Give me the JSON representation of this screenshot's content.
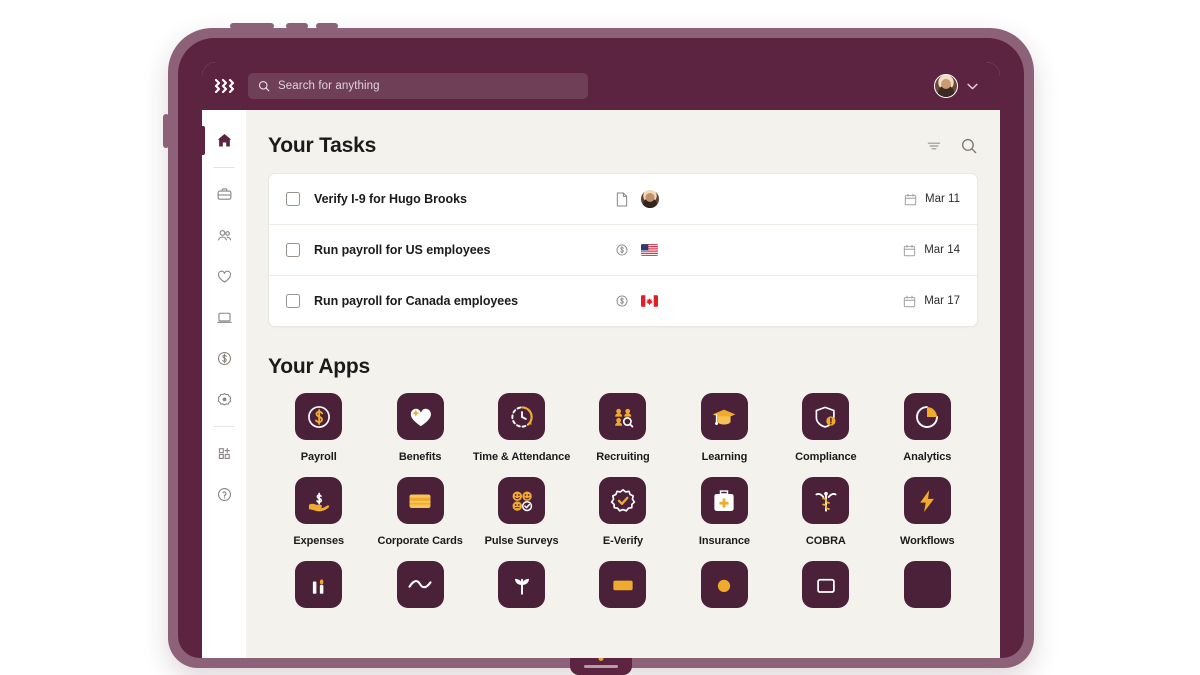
{
  "topbar": {
    "logo_icon": "rippling-logo-icon",
    "search": {
      "placeholder": "Search for anything",
      "value": "",
      "icon": "search-icon"
    },
    "account": {
      "avatar_icon": "user-avatar",
      "chevron_icon": "chevron-down-icon"
    }
  },
  "sidebar": {
    "items": [
      {
        "name": "home",
        "icon": "home-icon",
        "active": true
      },
      {
        "name": "briefcase",
        "icon": "briefcase-icon",
        "active": false
      },
      {
        "name": "people",
        "icon": "people-icon",
        "active": false
      },
      {
        "name": "benefits",
        "icon": "heart-icon",
        "active": false
      },
      {
        "name": "devices",
        "icon": "laptop-icon",
        "active": false
      },
      {
        "name": "payroll",
        "icon": "dollar-circle-icon",
        "active": false
      },
      {
        "name": "settings",
        "icon": "gear-badge-icon",
        "active": false
      },
      {
        "name": "add-apps",
        "icon": "apps-add-icon",
        "active": false
      },
      {
        "name": "help",
        "icon": "help-circle-icon",
        "active": false
      }
    ]
  },
  "tasks_section": {
    "title": "Your Tasks",
    "filter_icon": "filter-icon",
    "search_icon": "search-icon",
    "rows": [
      {
        "label": "Verify I-9 for Hugo Brooks",
        "type_icon": "document-icon",
        "entity_icon": "user-avatar",
        "entity_kind": "avatar",
        "date_icon": "calendar-icon",
        "date": "Mar 11"
      },
      {
        "label": "Run payroll for US employees",
        "type_icon": "dollar-circle-icon",
        "entity_icon": "flag-us",
        "entity_kind": "flag",
        "date_icon": "calendar-icon",
        "date": "Mar 14"
      },
      {
        "label": "Run payroll for Canada employees",
        "type_icon": "dollar-circle-icon",
        "entity_icon": "flag-ca",
        "entity_kind": "flag",
        "date_icon": "calendar-icon",
        "date": "Mar 17"
      }
    ]
  },
  "apps_section": {
    "title": "Your Apps",
    "apps": [
      {
        "label": "Payroll",
        "icon": "dollar-circle-icon"
      },
      {
        "label": "Benefits",
        "icon": "heart-plus-icon"
      },
      {
        "label": "Time & Attendance",
        "icon": "clock-arrow-icon"
      },
      {
        "label": "Recruiting",
        "icon": "people-search-icon"
      },
      {
        "label": "Learning",
        "icon": "graduation-cap-icon"
      },
      {
        "label": "Compliance",
        "icon": "shield-alert-icon"
      },
      {
        "label": "Analytics",
        "icon": "pie-chart-icon"
      },
      {
        "label": "Expenses",
        "icon": "hand-dollar-icon"
      },
      {
        "label": "Corporate Cards",
        "icon": "credit-card-icon"
      },
      {
        "label": "Pulse Surveys",
        "icon": "smiley-grid-icon"
      },
      {
        "label": "E-Verify",
        "icon": "verified-check-icon"
      },
      {
        "label": "Insurance",
        "icon": "first-aid-kit-icon"
      },
      {
        "label": "COBRA",
        "icon": "caduceus-icon"
      },
      {
        "label": "Workflows",
        "icon": "lightning-bolt-icon"
      }
    ],
    "partial_row_icons": [
      "candle-icon",
      "wave-icon",
      "plant-icon",
      "card-icon",
      "sun-icon",
      "note-icon",
      "blank-icon"
    ]
  },
  "colors": {
    "brand_dark": "#5c2440",
    "tile": "#4a2139",
    "bezel": "#8d6177",
    "accent_gold": "#f0ab2d",
    "page_bg": "#f4f2ed",
    "card_bg": "#ffffff"
  }
}
